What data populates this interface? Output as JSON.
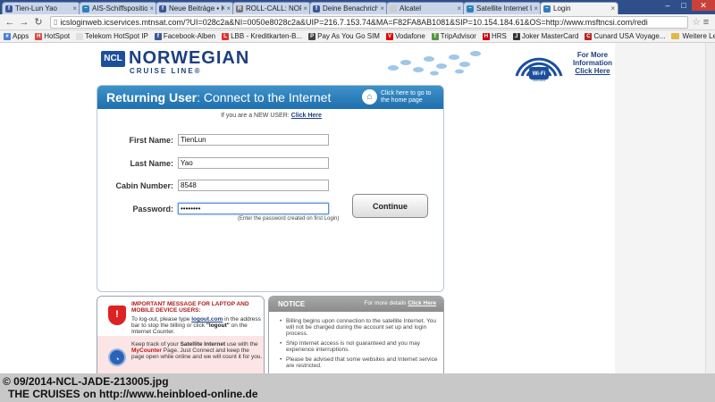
{
  "browser": {
    "tabs": [
      {
        "label": "Tien-Lun Yao",
        "favicon_color": "#3b5998",
        "favicon_glyph": "f"
      },
      {
        "label": "AIS-Schiffspositionen",
        "favicon_color": "#2f7fbf",
        "favicon_glyph": "~"
      },
      {
        "label": "Neue Beiträge • Kreuzf",
        "favicon_color": "#3b5998",
        "favicon_glyph": "f"
      },
      {
        "label": "ROLL-CALL: NORW",
        "favicon_color": "#777777",
        "favicon_glyph": "R"
      },
      {
        "label": "Deine Benachrichtigu",
        "favicon_color": "#3b5998",
        "favicon_glyph": "f"
      },
      {
        "label": "Alcatel",
        "favicon_color": "#cccccc",
        "favicon_glyph": ""
      },
      {
        "label": "Satellite Internet U",
        "favicon_color": "#2f7fbf",
        "favicon_glyph": "~"
      },
      {
        "label": "Login",
        "favicon_color": "#2f7fbf",
        "favicon_glyph": "~",
        "active": true
      }
    ],
    "address": "icsloginweb.icservices.mtnsat.com/?UI=028c2a&NI=0050e8028c2a&UIP=216.7.153.74&MA=F82FA8AB1081&SIP=10.154.184.61&OS=http://www.msftncsi.com/redi",
    "bookmarks": [
      {
        "label": "Apps",
        "color": "#4a7fd6",
        "glyph": "#"
      },
      {
        "label": "HotSpot",
        "color": "#d84a3a",
        "glyph": "H"
      },
      {
        "label": "Telekom HotSpot IP",
        "color": "#e0e0e0",
        "glyph": ""
      },
      {
        "label": "Facebook-Alben",
        "color": "#3b5998",
        "glyph": "f"
      },
      {
        "label": "LBB - Kreditkarten-B...",
        "color": "#d33",
        "glyph": "L"
      },
      {
        "label": "Pay As You Go SIM",
        "color": "#444",
        "glyph": "P"
      },
      {
        "label": "Vodafone",
        "color": "#e60000",
        "glyph": "V"
      },
      {
        "label": "TripAdvisor",
        "color": "#589442",
        "glyph": "T"
      },
      {
        "label": "HRS",
        "color": "#c00",
        "glyph": "H"
      },
      {
        "label": "Joker MasterCard",
        "color": "#333",
        "glyph": "J"
      },
      {
        "label": "Cunard USA Voyage...",
        "color": "#b22",
        "glyph": "C"
      }
    ],
    "other_bookmarks": "Weitere Lesezeichen"
  },
  "header": {
    "logo_abbr": "NCL",
    "logo_name": "NORWEGIAN",
    "logo_sub": "CRUISE LINE®",
    "wifi_badge_label": "Wi-Fi",
    "wifi_badge_sub": "onboard",
    "wifi_info_line1": "For More",
    "wifi_info_line2": "Information",
    "wifi_info_link": "Click Here"
  },
  "login": {
    "title_bold": "Returning User",
    "title_rest": ": Connect to the Internet",
    "home_link": "Click here to go to the home page",
    "new_user_prefix": "If you are a NEW USER:",
    "new_user_link": "Click Here",
    "first_name_label": "First Name:",
    "first_name_value": "TienLun",
    "last_name_label": "Last Name:",
    "last_name_value": "Yao",
    "cabin_label": "Cabin Number:",
    "cabin_value": "8548",
    "password_label": "Password:",
    "password_value": "••••••••",
    "password_hint": "(Enter the password created on first Login)",
    "continue_label": "Continue"
  },
  "important": {
    "title": "IMPORTANT MESSAGE FOR LAPTOP AND MOBILE DEVICE USERS:",
    "text_a": "To log-out, please type",
    "logout_link": "logout.com",
    "text_b": "in the address bar to stop the billing or click",
    "logout_quote": "\"logout\"",
    "text_c": "on the Internet Counter.",
    "track_a": "Keep track of your",
    "track_bold": "Satellite Internet",
    "track_b": "use with the",
    "counter_link": "MyCounter",
    "track_c": "Page. Just Connect and keep the page open while online and we will count it for you."
  },
  "notice": {
    "title": "NOTICE",
    "more_prefix": "For more details",
    "more_link": "Click Here",
    "items": [
      "Billing begins upon connection to the satellite Internet. You will not be charged during the account set up and login process.",
      "Ship Internet access is not guaranteed and you may experience interruptions.",
      "Please be advised that some websites and Internet service are restricted."
    ]
  },
  "caption": {
    "line1": "© 09/2014-NCL-JADE-213005.jpg",
    "line2": "THE CRUISES on http://www.heinbloed-online.de"
  }
}
